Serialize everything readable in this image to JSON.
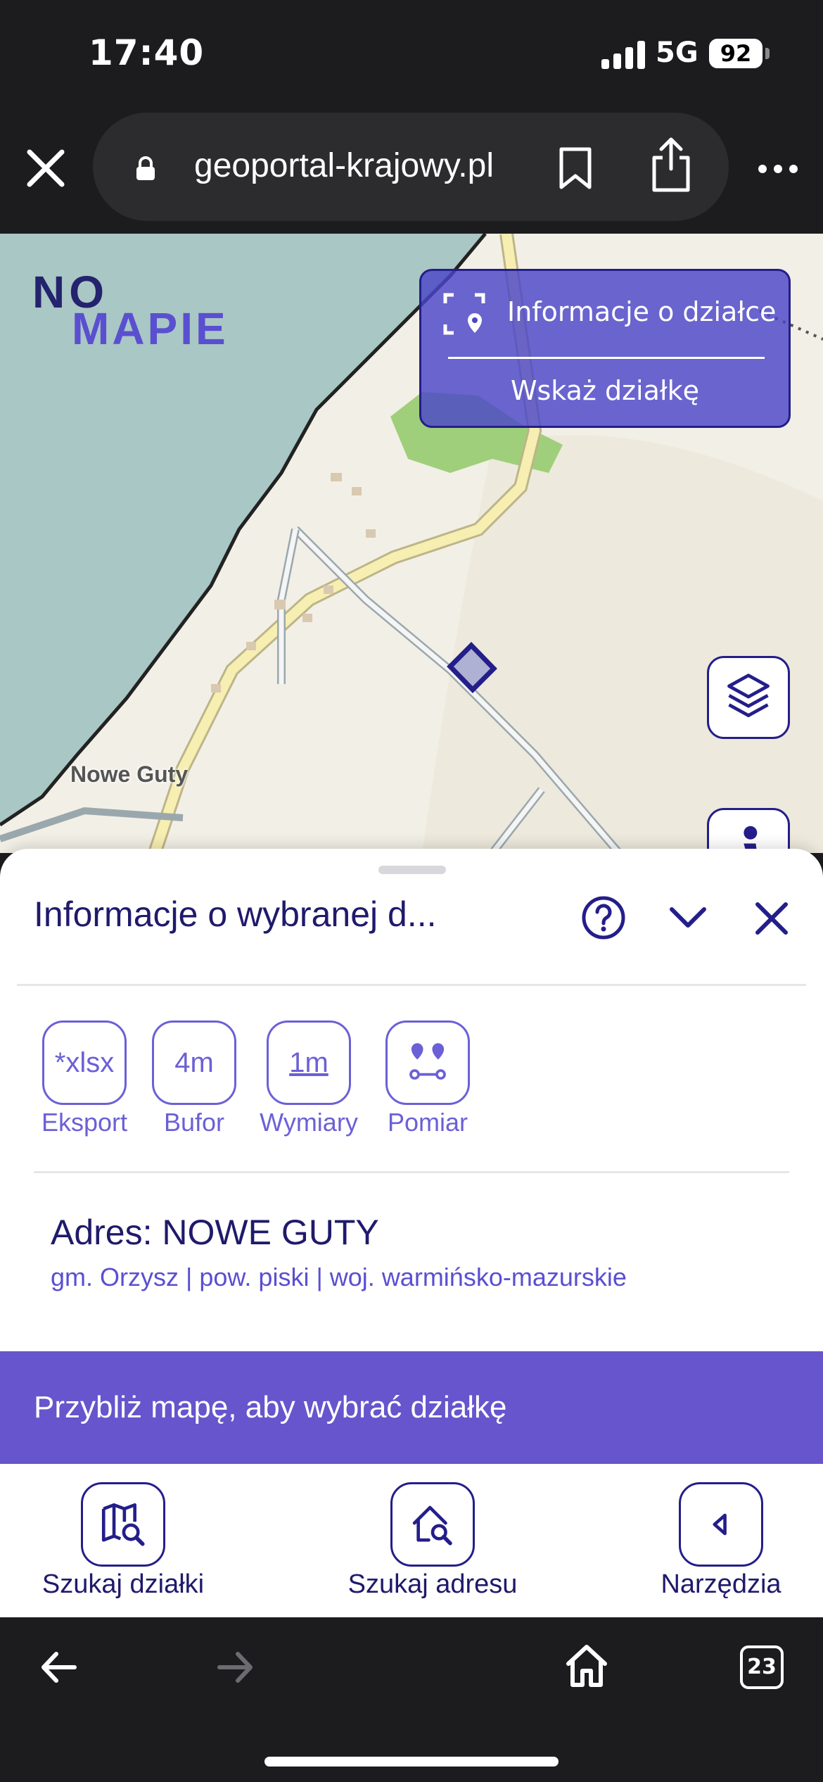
{
  "status": {
    "time": "17:40",
    "network": "5G",
    "battery": "92"
  },
  "browser": {
    "url": "geoportal-krajowy.pl",
    "tab_count": "23"
  },
  "map": {
    "logo_top": "NO",
    "logo_bottom": "MAPIE",
    "info_panel": {
      "title": "Informacje o działce",
      "action": "Wskaż działkę"
    },
    "town_label": "Nowe Guty"
  },
  "sheet": {
    "title": "Informacje o wybranej d...",
    "tools": [
      {
        "icon_text": "*xlsx",
        "label": "Eksport"
      },
      {
        "icon_text": "4m",
        "label": "Bufor"
      },
      {
        "icon_text": "1m",
        "label": "Wymiary"
      },
      {
        "icon_text": "",
        "label": "Pomiar"
      }
    ],
    "address": "Adres: NOWE GUTY",
    "address_detail": "gm. Orzysz | pow. piski | woj. warmińsko-mazurskie"
  },
  "banner": "Przybliż mapę, aby wybrać działkę",
  "nav": [
    {
      "label": "Szukaj działki",
      "icon": "map-search-icon"
    },
    {
      "label": "Szukaj adresu",
      "icon": "home-search-icon"
    },
    {
      "label": "Narzędzia",
      "icon": "triangle-left-icon"
    }
  ],
  "colors": {
    "accent": "#6655cc",
    "primary": "#241e8a",
    "panel": "#4b46c8"
  }
}
